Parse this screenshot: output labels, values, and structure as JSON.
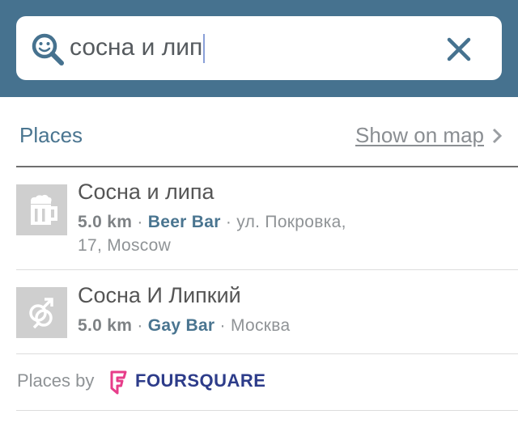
{
  "search": {
    "query": "сосна и лип",
    "icon": "search-icon",
    "clear_icon": "close-icon"
  },
  "section": {
    "title": "Places",
    "show_on_map": "Show on map"
  },
  "places": [
    {
      "name": "Сосна и липа",
      "distance": "5.0 km",
      "category": "Beer Bar",
      "address_line1": "ул. Покровка,",
      "address_line2": "17, Moscow",
      "icon": "beer-mug-icon"
    },
    {
      "name": "Сосна И Липкий",
      "distance": "5.0 km",
      "category": "Gay Bar",
      "address_line1": "Москва",
      "icon": "gender-symbols-icon"
    }
  ],
  "footer": {
    "label": "Places by",
    "brand": "FOURSQUARE"
  },
  "colors": {
    "header": "#46728f",
    "accent": "#4a7590",
    "foursquare_pink": "#e73d8a",
    "foursquare_navy": "#2d3c8a"
  }
}
